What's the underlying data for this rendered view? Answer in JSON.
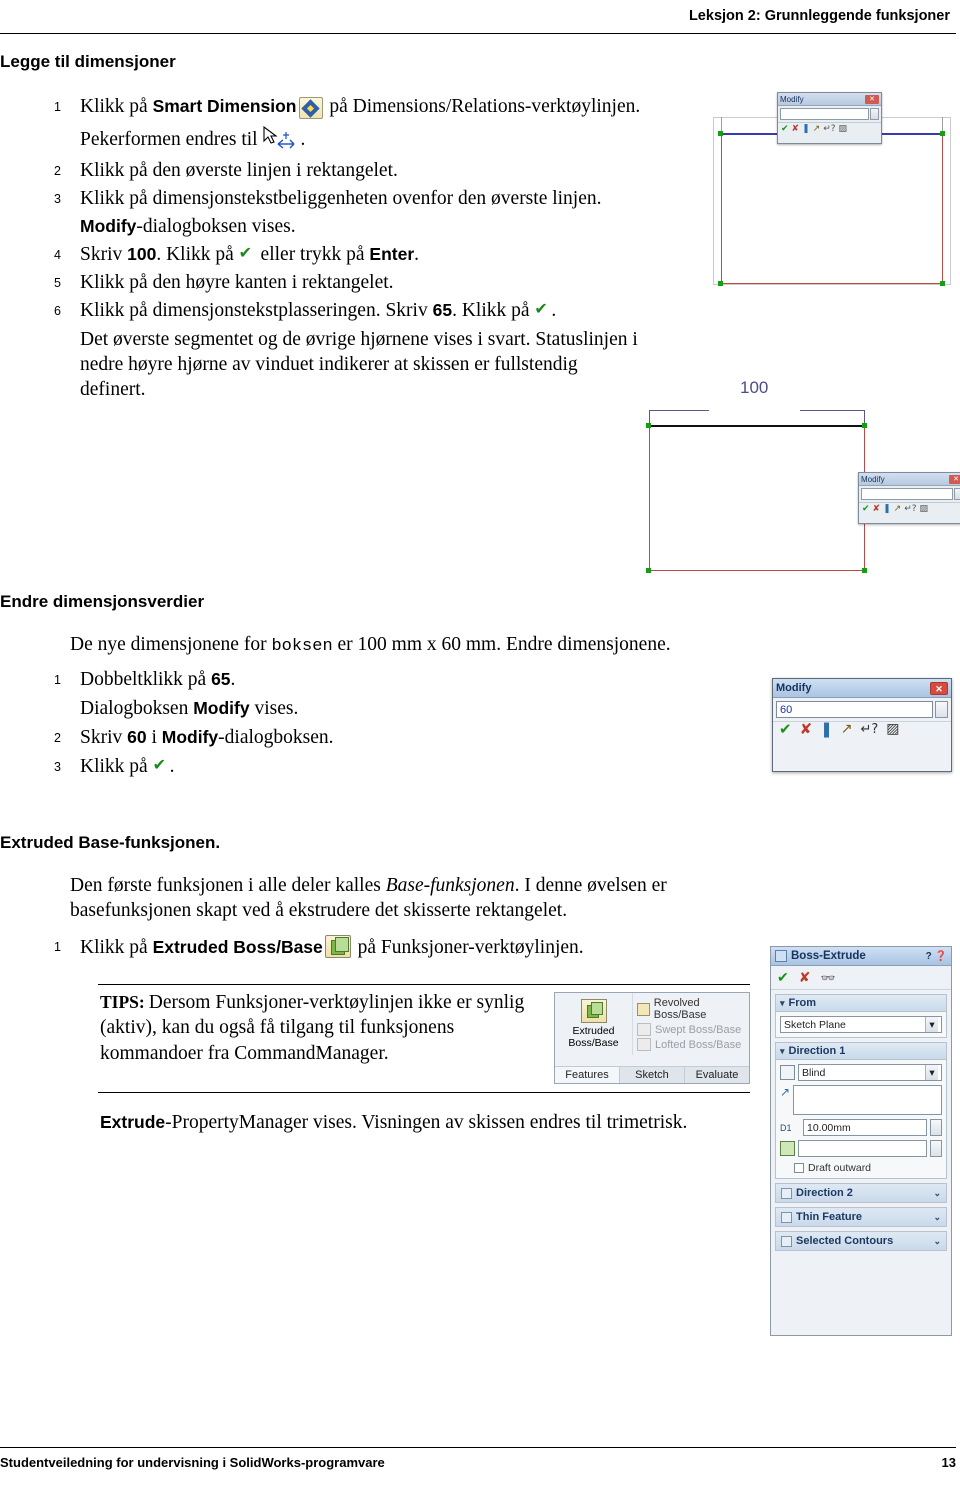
{
  "header": {
    "title": "Leksjon 2: Grunnleggende funksjoner"
  },
  "footer": {
    "left": "Studentveiledning for undervisning i SolidWorks-programvare",
    "right": "13"
  },
  "sections": {
    "add_dimensions": {
      "heading": "Legge til dimensjoner",
      "steps": [
        {
          "num": "1",
          "text_a": "Klikk på ",
          "bold": "Smart Dimension",
          "icon": "smart-dimension-icon",
          "text_b": " på Dimensions/Relations-verktøylinjen."
        },
        {
          "num": "",
          "text_a": "Pekerformen endres til ",
          "icon": "dimension-cursor-icon",
          "text_b": "."
        },
        {
          "num": "2",
          "text_a": "Klikk på den øverste linjen i rektangelet.",
          "bold": "",
          "text_b": ""
        },
        {
          "num": "3",
          "text_a": "Klikk på dimensjonstekstbeliggenheten ovenfor den øverste linjen.",
          "bold": "",
          "text_b": ""
        },
        {
          "num": "",
          "bold": "Modify",
          "text_b": "-dialogboksen vises."
        },
        {
          "num": "4",
          "text_a": "Skriv ",
          "bold": "100",
          "text_b": ". Klikk på ",
          "icon": "green-check-icon",
          "text_c": " eller trykk på ",
          "bold2": "Enter",
          "text_d": "."
        },
        {
          "num": "5",
          "text_a": "Klikk på den høyre kanten i rektangelet.",
          "bold": "",
          "text_b": ""
        },
        {
          "num": "6",
          "text_a": "Klikk på dimensjonstekstplasseringen. Skriv ",
          "bold": "65",
          "text_b": ". Klikk på ",
          "icon": "green-check-icon",
          "text_c": "."
        },
        {
          "num": "",
          "text_a": "Det øverste segmentet og de øvrige hjørnene vises i svart. Statuslinjen i nedre høyre hjørne av vinduet indikerer at skissen er fullstendig definert.",
          "bold": "",
          "text_b": ""
        }
      ]
    },
    "change_dimensions": {
      "heading": "Endre dimensjonsverdier",
      "intro_a": "De nye dimensjonene for ",
      "intro_mono": "boksen",
      "intro_b": " er 100 mm x 60 mm. Endre dimensjonene.",
      "steps": [
        {
          "num": "1",
          "text_a": "Dobbeltklikk på ",
          "bold": "65",
          "text_b": "."
        },
        {
          "num": "",
          "text_a": "Dialogboksen ",
          "bold": "Modify",
          "text_b": " vises."
        },
        {
          "num": "2",
          "text_a": "Skriv ",
          "bold": "60",
          "text_b": " i ",
          "bold2": "Modify",
          "text_c": "-dialogboksen."
        },
        {
          "num": "3",
          "text_a": "Klikk på ",
          "icon": "green-check-icon",
          "text_b": "."
        }
      ]
    },
    "extruded_base": {
      "heading": "Extruded Base-funksjonen.",
      "para_a": "Den første funksjonen i alle deler kalles ",
      "para_italic": "Base-funksjonen",
      "para_b": ". I denne øvelsen er basefunksjonen skapt ved å ekstrudere det skisserte rektangelet.",
      "step1": {
        "num": "1",
        "text_a": "Klikk på ",
        "bold": "Extruded Boss/Base",
        "icon": "extruded-boss-base-icon",
        "text_b": " på Funksjoner-verktøylinjen."
      },
      "tip": {
        "label": "TIPS:",
        "text": "Dersom Funksjoner-verktøylinjen ikke er synlig (aktiv), kan du også få tilgang til funksjonens kommandoer fra CommandManager."
      },
      "closing": {
        "bold": "Extrude",
        "text": "-PropertyManager vises. Visningen av skissen endres til trimetrisk."
      }
    }
  },
  "figures": {
    "modify_small_top": {
      "title": "Modify",
      "value": "",
      "close": "✕"
    },
    "dimension_100": "100",
    "modify_small_mid": {
      "title": "Modify",
      "value": "",
      "close": "✕"
    },
    "modify_large": {
      "title": "Modify",
      "value": "60",
      "close": "✕"
    },
    "command_manager": {
      "left_label_1": "Extruded",
      "left_label_2": "Boss/Base",
      "items": [
        "Revolved Boss/Base",
        "Swept Boss/Base",
        "Lofted Boss/Base"
      ],
      "tabs": [
        "Features",
        "Sketch",
        "Evaluate"
      ],
      "active_tab": "Features"
    },
    "property_manager": {
      "title": "Boss-Extrude",
      "help": "?",
      "pin": "❓",
      "groups": [
        {
          "name": "From",
          "value": "Sketch Plane"
        },
        {
          "name": "Direction 1",
          "value": "Blind",
          "depth_label": "D1",
          "depth": "10.00mm",
          "draft_label": "Draft outward"
        }
      ],
      "collapsed": [
        "Direction 2",
        "Thin Feature",
        "Selected Contours"
      ]
    }
  },
  "colors": {
    "sketch_red": "#b94a48",
    "sketch_green": "#13a013",
    "sketch_blue": "#3a3ab0",
    "accent_blue": "#16335e"
  }
}
